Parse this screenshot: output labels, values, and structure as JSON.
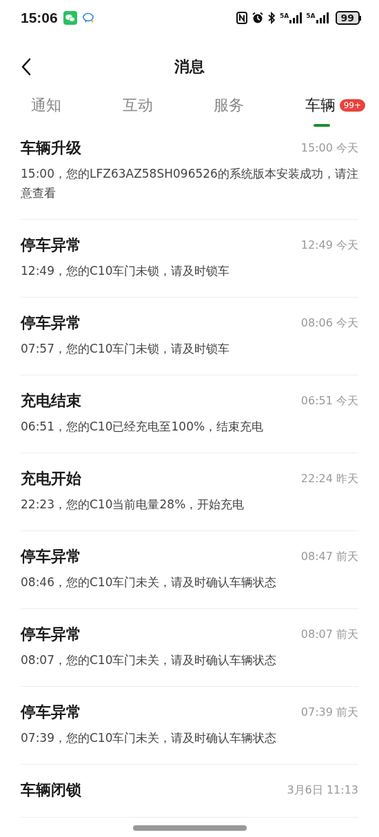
{
  "status_bar": {
    "time": "15:06",
    "network_labels": [
      "5A",
      "5A"
    ],
    "battery": "99"
  },
  "header": {
    "title": "消息"
  },
  "tabs": [
    {
      "label": "通知",
      "selected": false
    },
    {
      "label": "互动",
      "selected": false
    },
    {
      "label": "服务",
      "selected": false
    },
    {
      "label": "车辆",
      "selected": true,
      "badge": "99+"
    }
  ],
  "messages": [
    {
      "title": "车辆升级",
      "time": "15:00 今天",
      "body": "15:00，您的LFZ63AZ58SH096526的系统版本安装成功，请注意查看"
    },
    {
      "title": "停车异常",
      "time": "12:49 今天",
      "body": "12:49，您的C10车门未锁，请及时锁车"
    },
    {
      "title": "停车异常",
      "time": "08:06 今天",
      "body": "07:57，您的C10车门未锁，请及时锁车"
    },
    {
      "title": "充电结束",
      "time": "06:51 今天",
      "body": "06:51，您的C10已经充电至100%，结束充电"
    },
    {
      "title": "充电开始",
      "time": "22:24 昨天",
      "body": "22:23，您的C10当前电量28%，开始充电"
    },
    {
      "title": "停车异常",
      "time": "08:47 前天",
      "body": "08:46，您的C10车门未关，请及时确认车辆状态"
    },
    {
      "title": "停车异常",
      "time": "08:07 前天",
      "body": "08:07，您的C10车门未关，请及时确认车辆状态"
    },
    {
      "title": "停车异常",
      "time": "07:39 前天",
      "body": "07:39，您的C10车门未关，请及时确认车辆状态"
    },
    {
      "title": "车辆闭锁",
      "time": "3月6日 11:13"
    }
  ]
}
